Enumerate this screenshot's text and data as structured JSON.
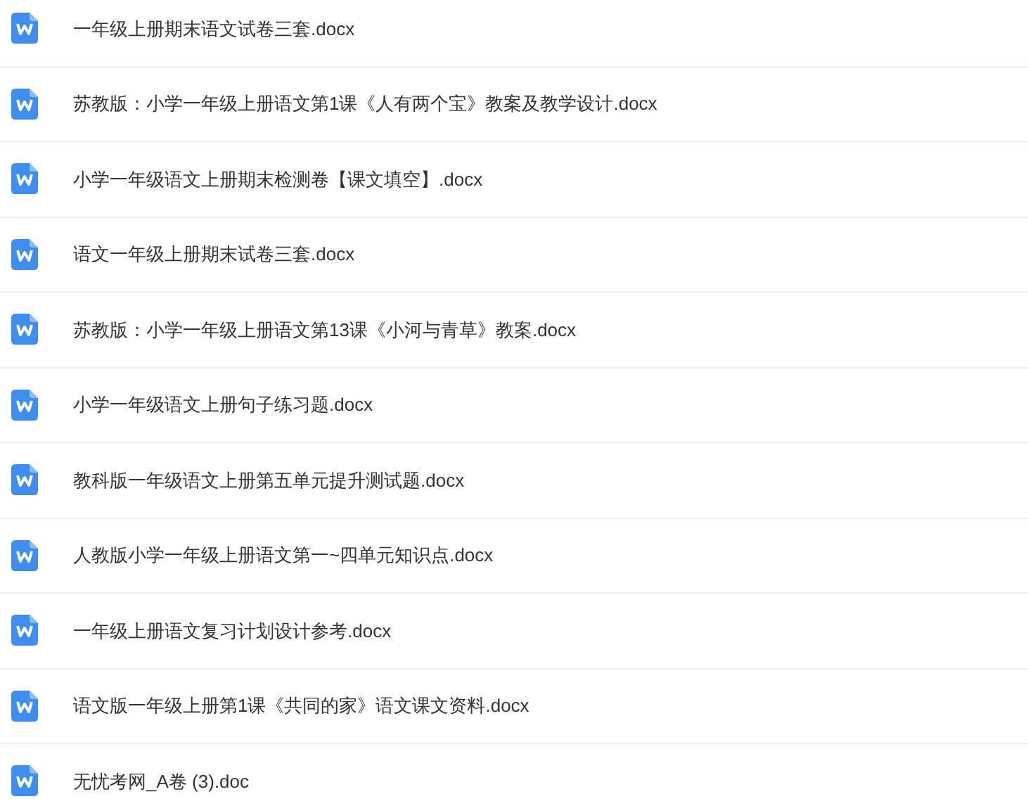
{
  "files": [
    {
      "name": "一年级上册期末语文试卷三套.docx"
    },
    {
      "name": "苏教版：小学一年级上册语文第1课《人有两个宝》教案及教学设计.docx"
    },
    {
      "name": "小学一年级语文上册期末检测卷【课文填空】.docx"
    },
    {
      "name": "语文一年级上册期末试卷三套.docx"
    },
    {
      "name": "苏教版：小学一年级上册语文第13课《小河与青草》教案.docx"
    },
    {
      "name": "小学一年级语文上册句子练习题.docx"
    },
    {
      "name": "教科版一年级语文上册第五单元提升测试题.docx"
    },
    {
      "name": "人教版小学一年级上册语文第一~四单元知识点.docx"
    },
    {
      "name": "一年级上册语文复习计划设计参考.docx"
    },
    {
      "name": "语文版一年级上册第1课《共同的家》语文课文资料.docx"
    },
    {
      "name": "无忧考网_A卷 (3).doc"
    }
  ]
}
